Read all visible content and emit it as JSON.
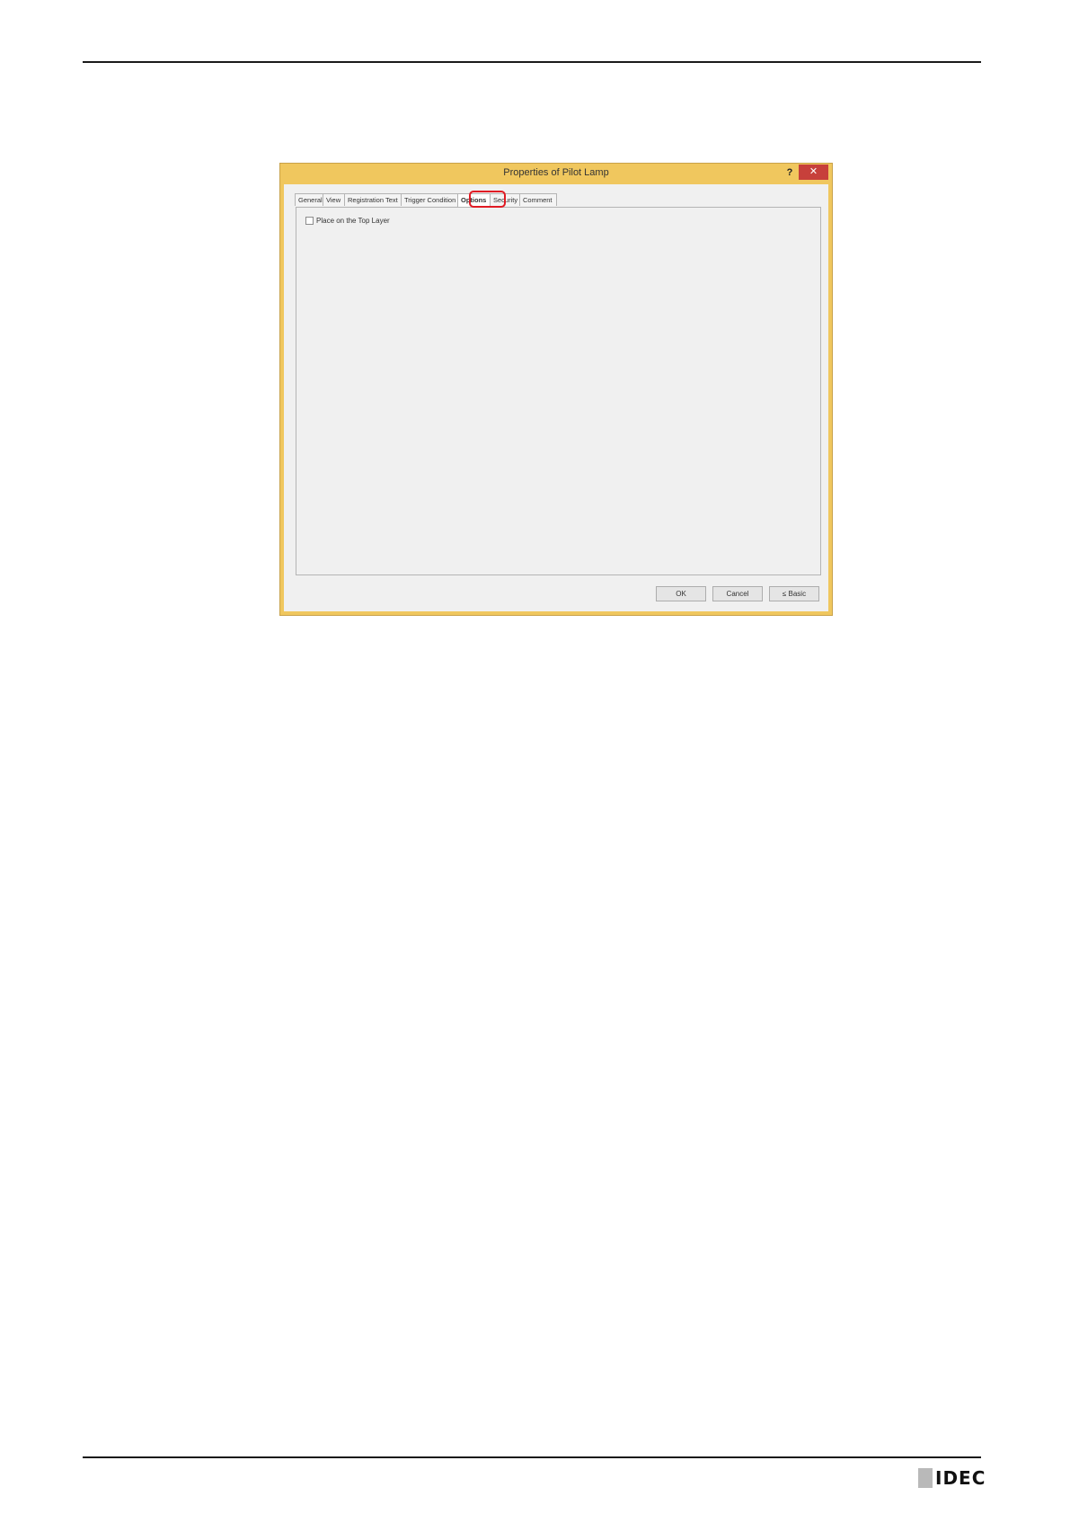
{
  "dialog": {
    "title": "Properties of Pilot Lamp",
    "help_label": "?",
    "close_label": "✕",
    "tabs": [
      {
        "label": "General"
      },
      {
        "label": "View"
      },
      {
        "label": "Registration Text"
      },
      {
        "label": "Trigger Condition"
      },
      {
        "label": "Options"
      },
      {
        "label": "Security"
      },
      {
        "label": "Comment"
      }
    ],
    "active_tab": "Options",
    "options": {
      "place_on_top_layer_label": "Place on the Top Layer",
      "place_on_top_layer_checked": false
    },
    "buttons": {
      "ok": "OK",
      "cancel": "Cancel",
      "basic": "≤ Basic"
    },
    "colors": {
      "frame": "#f0c75e",
      "close": "#c7403b",
      "highlight": "#e01b24"
    }
  },
  "footer": {
    "logo_text": "IDEC"
  }
}
